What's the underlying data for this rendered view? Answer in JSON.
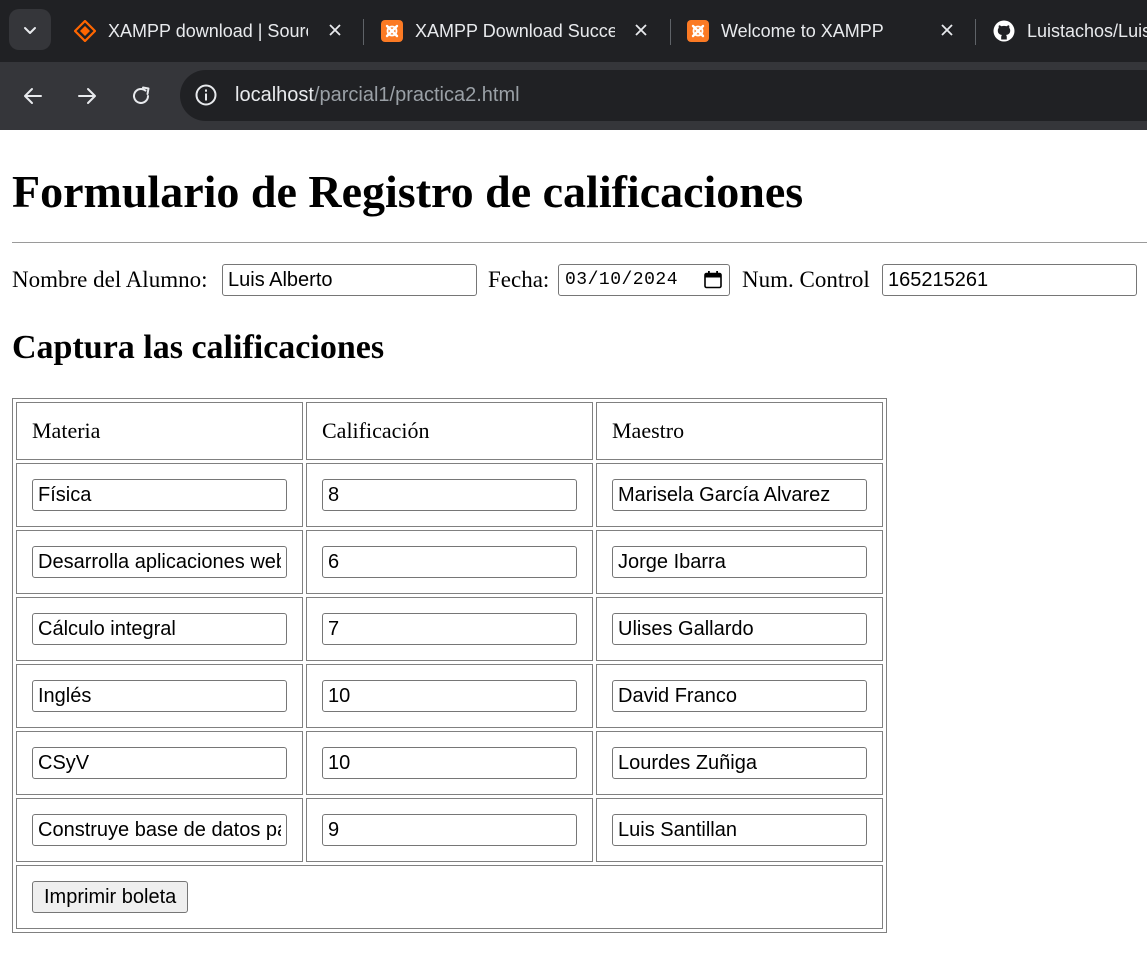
{
  "browser": {
    "tabs": [
      {
        "title": "XAMPP download | SourceForge",
        "icon": "sourceforge-icon",
        "icon_color": "#ff6600"
      },
      {
        "title": "XAMPP Download Success",
        "icon": "xampp-icon",
        "icon_color": "#fb7a24"
      },
      {
        "title": "Welcome to XAMPP",
        "icon": "xampp-icon",
        "icon_color": "#fb7a24"
      },
      {
        "title": "Luistachos/Luis",
        "icon": "github-icon",
        "icon_color": "#ffffff"
      }
    ],
    "address": {
      "host": "localhost",
      "path": "/parcial1/practica2.html"
    }
  },
  "page": {
    "title": "Formulario de Registro de calificaciones",
    "student": {
      "name_label": "Nombre del Alumno:",
      "name_value": "Luis Alberto",
      "date_label": "Fecha:",
      "date_value": "03/10/2024",
      "control_label": "Num. Control",
      "control_value": "165215261"
    },
    "subtitle": "Captura las calificaciones",
    "table": {
      "headers": [
        "Materia",
        "Calificación",
        "Maestro"
      ],
      "rows": [
        {
          "materia": "Física",
          "calificacion": "8",
          "maestro": "Marisela García Alvarez"
        },
        {
          "materia": "Desarrolla aplicaciones web",
          "calificacion": "6",
          "maestro": "Jorge Ibarra"
        },
        {
          "materia": "Cálculo integral",
          "calificacion": "7",
          "maestro": "Ulises Gallardo"
        },
        {
          "materia": "Inglés",
          "calificacion": "10",
          "maestro": "David Franco"
        },
        {
          "materia": "CSyV",
          "calificacion": "10",
          "maestro": "Lourdes Zuñiga"
        },
        {
          "materia": "Construye base de datos para",
          "calificacion": "9",
          "maestro": "Luis Santillan"
        }
      ]
    },
    "print_button": "Imprimir boleta"
  }
}
